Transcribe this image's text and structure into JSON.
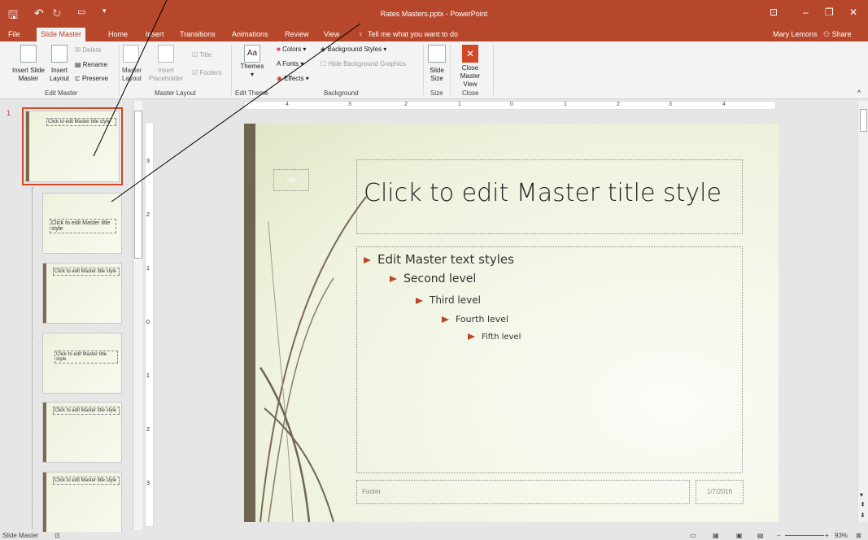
{
  "window": {
    "title": "Rates Masters.pptx - PowerPoint",
    "user": "Mary Lemons",
    "share": "Share"
  },
  "tabs": [
    "File",
    "Slide Master",
    "Home",
    "Insert",
    "Transitions",
    "Animations",
    "Review",
    "View"
  ],
  "tell_me": "Tell me what you want to do",
  "ribbon": {
    "insert_slide_master": "Insert Slide Master",
    "insert_layout": "Insert Layout",
    "delete": "Delete",
    "rename": "Rename",
    "preserve": "Preserve",
    "master_layout": "Master Layout",
    "insert_placeholder": "Insert Placeholder",
    "title_cb": "Title",
    "footers_cb": "Footers",
    "themes": "Themes",
    "colors": "Colors",
    "fonts": "Fonts",
    "effects": "Effects",
    "background_styles": "Background Styles",
    "hide_bg": "Hide Background Graphics",
    "slide_size": "Slide Size",
    "close_master": "Close Master View",
    "groups": [
      "Edit Master",
      "Master Layout",
      "Edit Theme",
      "Background",
      "Size",
      "Close"
    ]
  },
  "thumbs": {
    "number": "1",
    "master_title": "Click to edit Master title style",
    "layout2_title": "Click to edit Master title style",
    "layout3_title": "Click to edit Master title style",
    "layout4_title": "Click to edit Master title style",
    "layout5_title": "Click to edit Master title style",
    "layout6_title": "Click to edit Master title style"
  },
  "slide": {
    "num": "‹#›",
    "title": "Click to edit Master title style",
    "levels": [
      "Edit Master text styles",
      "Second level",
      "Third level",
      "Fourth level",
      "Fifth level"
    ],
    "footer": "Footer",
    "date": "1/7/2016"
  },
  "ruler": [
    "4",
    "3",
    "2",
    "1",
    "0",
    "1",
    "2",
    "3",
    "4"
  ],
  "vruler": [
    "3",
    "2",
    "1",
    "0",
    "1",
    "2",
    "3"
  ],
  "status": {
    "view": "Slide Master",
    "zoom": "93%"
  },
  "colors": {
    "accent": "#b7472a",
    "bar": "#6f6651"
  }
}
